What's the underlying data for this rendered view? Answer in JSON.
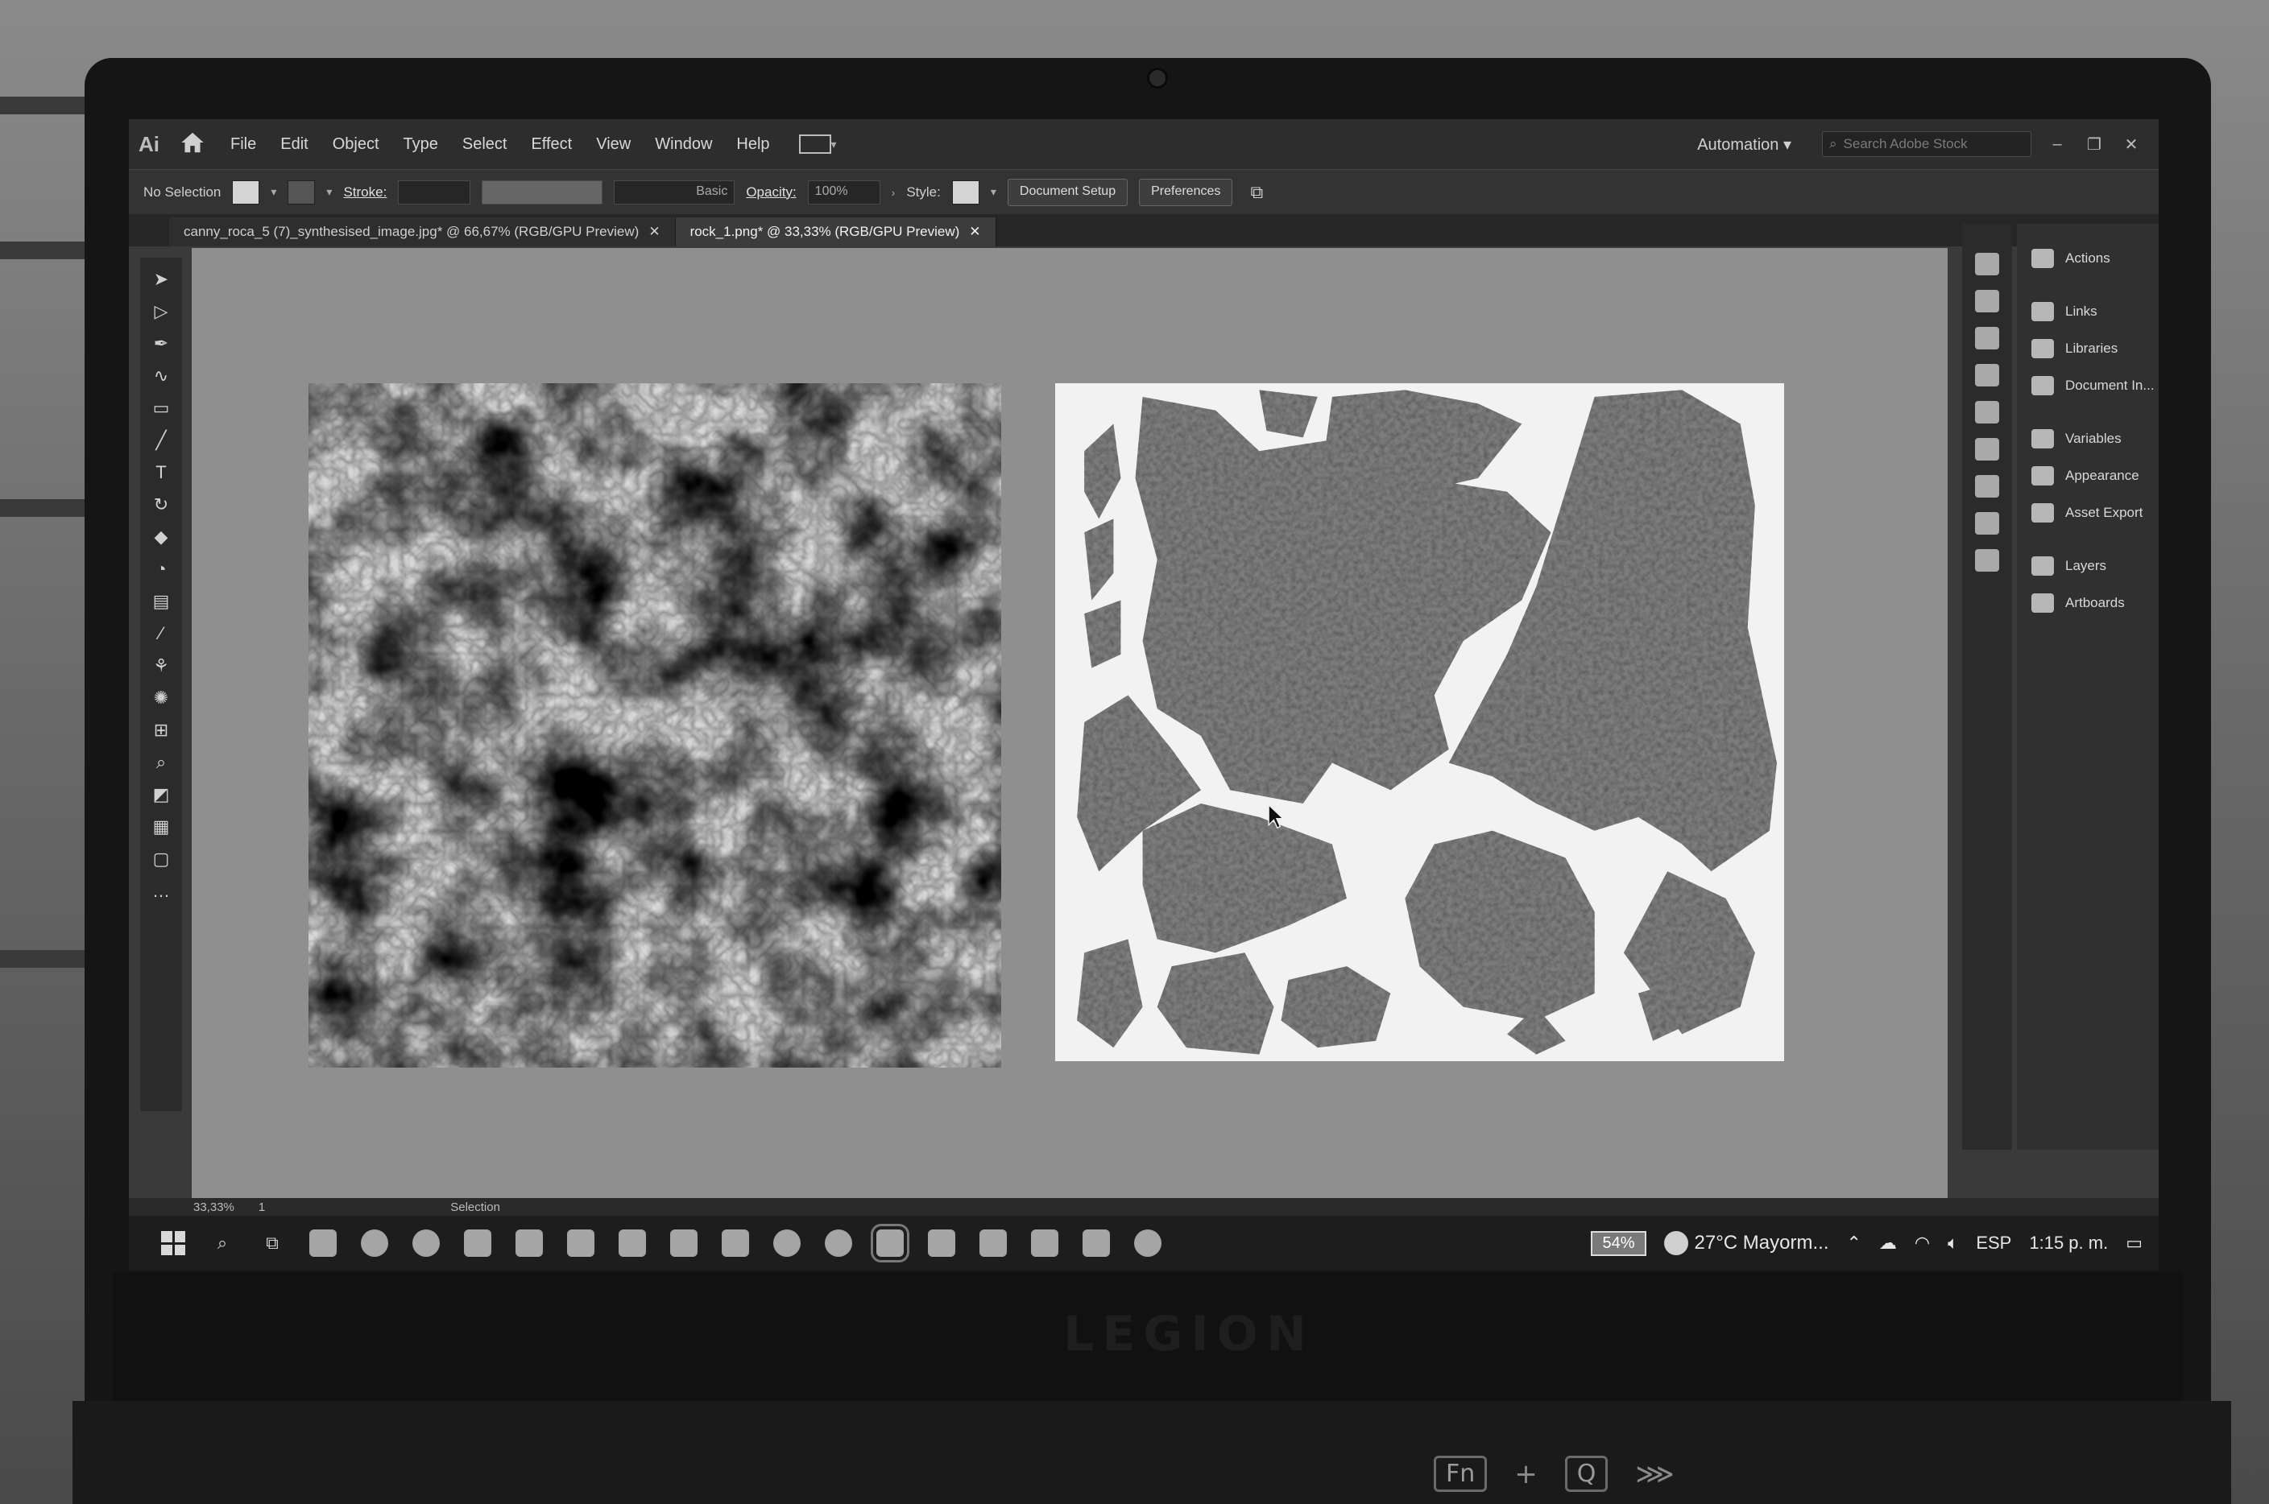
{
  "app": {
    "logo": "Ai",
    "menu": [
      "File",
      "Edit",
      "Object",
      "Type",
      "Select",
      "Effect",
      "View",
      "Window",
      "Help"
    ],
    "workspace": "Automation",
    "search_placeholder": "Search Adobe Stock"
  },
  "control_bar": {
    "selection": "No Selection",
    "stroke_label": "Stroke:",
    "stroke_style": "Basic",
    "opacity_label": "Opacity:",
    "opacity_value": "100%",
    "style_label": "Style:",
    "document_setup": "Document Setup",
    "preferences": "Preferences"
  },
  "tabs": [
    {
      "label": "canny_roca_5 (7)_synthesised_image.jpg* @ 66,67% (RGB/GPU Preview)",
      "active": false
    },
    {
      "label": "rock_1.png* @ 33,33% (RGB/GPU Preview)",
      "active": true
    }
  ],
  "panels": [
    "Actions",
    "Links",
    "Libraries",
    "Document In...",
    "Variables",
    "Appearance",
    "Asset Export",
    "Layers",
    "Artboards"
  ],
  "status": {
    "zoom": "33,33%",
    "artboard": "1",
    "tool": "Selection"
  },
  "taskbar": {
    "battery": "54%",
    "weather": "27°C Mayorm...",
    "lang": "ESP",
    "time": "1:15 p. m."
  },
  "hardware": {
    "brand": "LEGION",
    "keys": [
      "Fn",
      "+",
      "Q"
    ]
  }
}
